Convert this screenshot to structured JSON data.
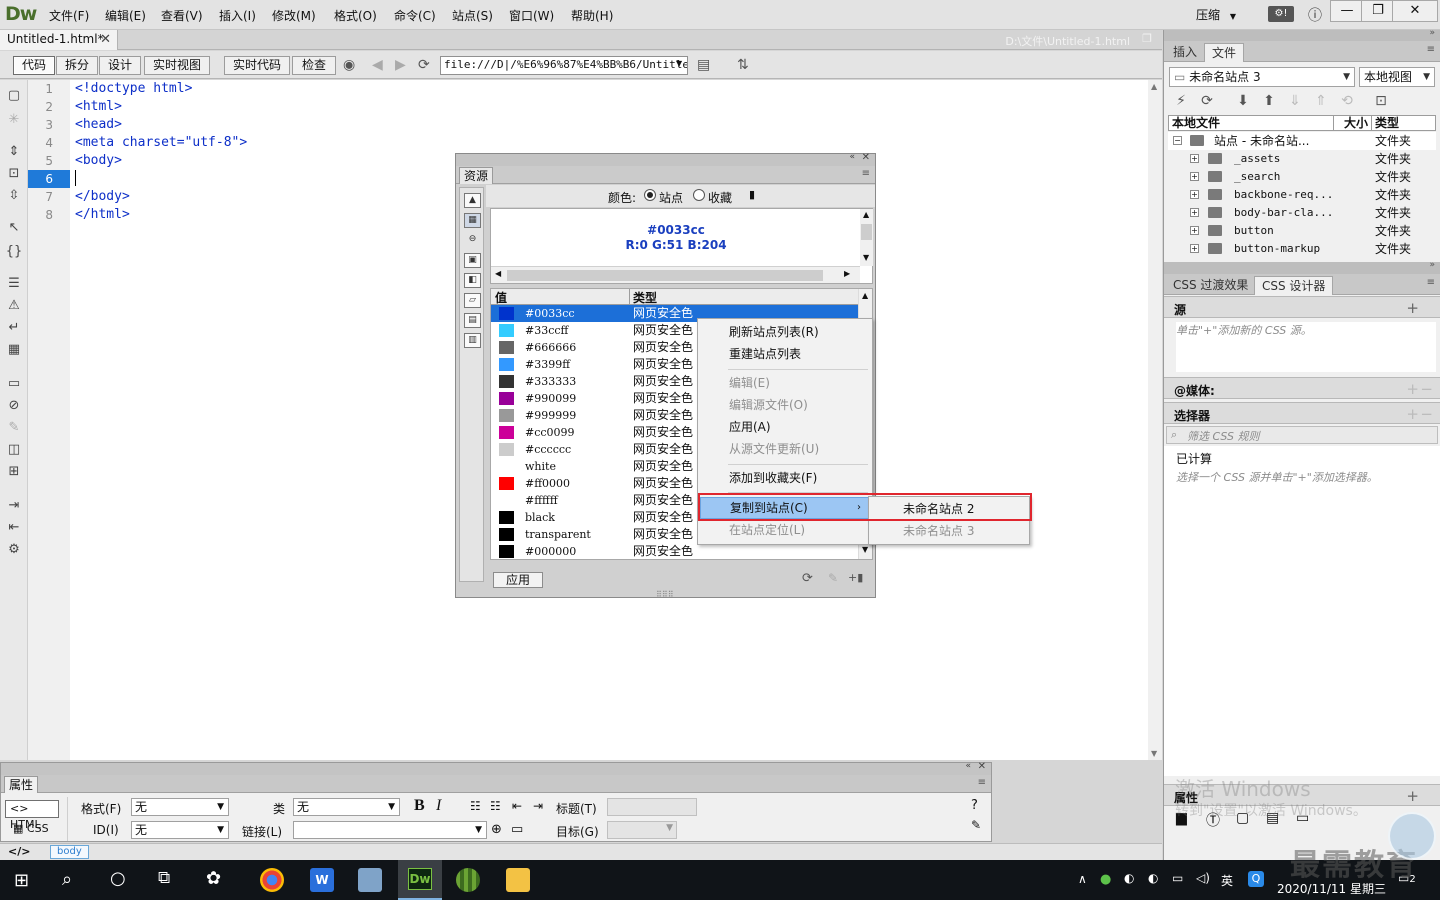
{
  "app": {
    "logo": "Dw",
    "menu": [
      "文件(F)",
      "编辑(E)",
      "查看(V)",
      "插入(I)",
      "修改(M)",
      "格式(O)",
      "命令(C)",
      "站点(S)",
      "窗口(W)",
      "帮助(H)"
    ],
    "compress_label": "压缩",
    "window_controls": [
      "minimize-icon",
      "restore-icon",
      "close-icon"
    ]
  },
  "document": {
    "tab_name": "Untitled-1.html*",
    "path": "D:\\文件\\Untitled-1.html"
  },
  "toolbar": {
    "code": "代码",
    "split": "拆分",
    "design": "设计",
    "live_view": "实时视图",
    "live_code": "实时代码",
    "inspect": "检查",
    "address": "file:///D|/%E6%96%87%E4%BB%B6/Untitled"
  },
  "editor": {
    "line_numbers": [
      "1",
      "2",
      "3",
      "4",
      "5",
      "6",
      "7",
      "8"
    ],
    "current_line": 6,
    "lines": [
      "<!doctype html>",
      "<html>",
      "<head>",
      "<meta charset=\"utf-8\">",
      "<body>",
      "",
      "</body>",
      "</html>"
    ]
  },
  "right_panel": {
    "tabs": [
      "插入",
      "文件"
    ],
    "active_tab": "文件",
    "site_select": "未命名站点 3",
    "view_select": "本地视图",
    "columns": [
      "本地文件",
      "大小",
      "类型"
    ],
    "files": [
      {
        "name": "站点 - 未命名站...",
        "type": "文件夹",
        "level": 0
      },
      {
        "name": "_assets",
        "type": "文件夹",
        "level": 1
      },
      {
        "name": "_search",
        "type": "文件夹",
        "level": 1
      },
      {
        "name": "backbone-req...",
        "type": "文件夹",
        "level": 1
      },
      {
        "name": "body-bar-cla...",
        "type": "文件夹",
        "level": 1
      },
      {
        "name": "button",
        "type": "文件夹",
        "level": 1
      },
      {
        "name": "button-markup",
        "type": "文件夹",
        "level": 1
      }
    ],
    "css_tabs": [
      "CSS 过渡效果",
      "CSS 设计器"
    ],
    "css_active": "CSS 设计器",
    "source_title": "源",
    "source_hint": "单击\"+\"添加新的 CSS 源。",
    "media_title": "@媒体:",
    "selector_title": "选择器",
    "filter_placeholder": "筛选 CSS 规则",
    "computed_title": "已计算",
    "computed_hint": "选择一个 CSS 源并单击\"+\"添加选择器。",
    "attr_title": "属性"
  },
  "assets_panel": {
    "tab": "资源",
    "color_label": "颜色:",
    "radio_site": "站点",
    "radio_fav": "收藏",
    "preview_hex": "#0033cc",
    "preview_rgb": "R:0 G:51 B:204",
    "col_value": "值",
    "col_type": "类型",
    "colors": [
      {
        "value": "#0033cc",
        "swatch": "#0033cc",
        "type": "网页安全色"
      },
      {
        "value": "#33ccff",
        "swatch": "#33ccff",
        "type": "网页安全色"
      },
      {
        "value": "#666666",
        "swatch": "#666666",
        "type": "网页安全色"
      },
      {
        "value": "#3399ff",
        "swatch": "#3399ff",
        "type": "网页安全色"
      },
      {
        "value": "#333333",
        "swatch": "#333333",
        "type": "网页安全色"
      },
      {
        "value": "#990099",
        "swatch": "#990099",
        "type": "网页安全色"
      },
      {
        "value": "#999999",
        "swatch": "#999999",
        "type": "网页安全色"
      },
      {
        "value": "#cc0099",
        "swatch": "#cc0099",
        "type": "网页安全色"
      },
      {
        "value": "#cccccc",
        "swatch": "#cccccc",
        "type": "网页安全色"
      },
      {
        "value": "white",
        "swatch": "#ffffff",
        "type": "网页安全色"
      },
      {
        "value": "#ff0000",
        "swatch": "#ff0000",
        "type": "网页安全色"
      },
      {
        "value": "#ffffff",
        "swatch": "#ffffff",
        "type": "网页安全色"
      },
      {
        "value": "black",
        "swatch": "#000000",
        "type": "网页安全色"
      },
      {
        "value": "transparent",
        "swatch": "#000000",
        "type": "网页安全色"
      },
      {
        "value": "#000000",
        "swatch": "#000000",
        "type": "网页安全色"
      }
    ],
    "apply_button": "应用"
  },
  "context_menu": {
    "items": [
      {
        "label": "刷新站点列表(R)",
        "disabled": false
      },
      {
        "label": "重建站点列表",
        "disabled": false
      },
      {
        "label": "编辑(E)",
        "disabled": true
      },
      {
        "label": "编辑源文件(O)",
        "disabled": true
      },
      {
        "label": "应用(A)",
        "disabled": false
      },
      {
        "label": "从源文件更新(U)",
        "disabled": true
      },
      {
        "label": "添加到收藏夹(F)",
        "disabled": false
      },
      {
        "label": "复制到站点(C)",
        "disabled": false
      },
      {
        "label": "在站点定位(L)",
        "disabled": true
      }
    ],
    "submenu": [
      "未命名站点 2",
      "未命名站点 3"
    ]
  },
  "properties": {
    "tab": "属性",
    "html_btn": "HTML",
    "css_btn": "CSS",
    "format_label": "格式(F)",
    "format_value": "无",
    "class_label": "类",
    "class_value": "无",
    "id_label": "ID(I)",
    "id_value": "无",
    "link_label": "链接(L)",
    "title_label": "标题(T)",
    "target_label": "目标(G)",
    "bold": "B",
    "italic": "I"
  },
  "tagbar": {
    "tag": "body"
  },
  "watermark": {
    "activate": "激活 Windows",
    "activate_sub": "转到\"设置\"以激活 Windows。",
    "brand": "最需教育"
  },
  "taskbar": {
    "ime": "英",
    "date": "2020/11/11 星期三",
    "notif_count": "2"
  }
}
